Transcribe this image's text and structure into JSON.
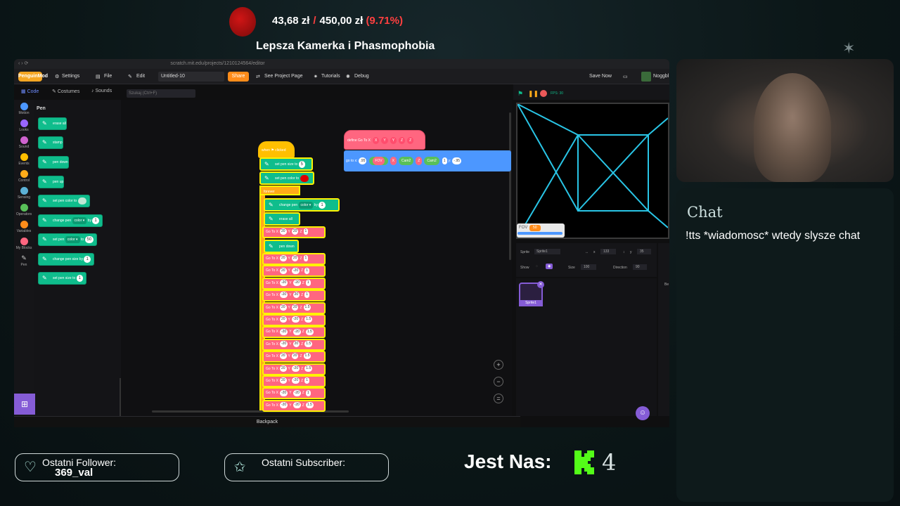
{
  "goal": {
    "current": "43,68 zł",
    "separator": "/",
    "target": "450,00 zł",
    "percent": "(9.71%)"
  },
  "stream_title": "Lepsza Kamerka i Phasmophobia",
  "browser": {
    "url": "scratch.mit.edu/projects/1210124564/editor",
    "menu": {
      "logo": "PenguinMod",
      "settings": "Settings",
      "file": "File",
      "edit": "Edit",
      "project_title": "Untitled-10",
      "share": "Share",
      "see_project": "See Project Page",
      "tutorials": "Tutorials",
      "debug": "Debug",
      "save_now": "Save Now",
      "user": "Noggbl"
    },
    "tabs": {
      "code": "Code",
      "costumes": "Costumes",
      "sounds": "Sounds"
    },
    "search_placeholder": "Szukaj (Ctrl+F)",
    "categories": [
      {
        "label": "Motion",
        "color": "#4c97ff"
      },
      {
        "label": "Looks",
        "color": "#9966ff"
      },
      {
        "label": "Sound",
        "color": "#cf63cf"
      },
      {
        "label": "Events",
        "color": "#ffbf00"
      },
      {
        "label": "Control",
        "color": "#ffab19"
      },
      {
        "label": "Sensing",
        "color": "#5cb1d6"
      },
      {
        "label": "Operators",
        "color": "#59c059"
      },
      {
        "label": "Variables",
        "color": "#ff8c1a"
      },
      {
        "label": "My Blocks",
        "color": "#ff6680"
      },
      {
        "label": "Pen",
        "color": "#0fbd8c"
      }
    ],
    "palette": {
      "title": "Pen",
      "blocks": [
        {
          "label": "erase all"
        },
        {
          "label": "stamp"
        },
        {
          "label": "pen down"
        },
        {
          "label": "pen up"
        },
        {
          "label": "set pen color to"
        },
        {
          "label": "change pen",
          "opt": "color ▾",
          "by": "by",
          "val": "1"
        },
        {
          "label": "set pen",
          "opt": "color ▾",
          "by": "to",
          "val": "50"
        },
        {
          "label": "change pen size by",
          "val": "1"
        },
        {
          "label": "set pen size to",
          "val": "1"
        }
      ]
    },
    "script": {
      "hat": "when ⚑ clicked",
      "set_size": {
        "label": "set pen size to",
        "val": "5"
      },
      "set_color": "set pen color to",
      "forever": "forever",
      "change_pen": {
        "label": "change pen",
        "opt": "color ▾",
        "by": "by",
        "val": "1"
      },
      "erase": "erase all",
      "goto_first": {
        "label": "Go To X",
        "x": "20",
        "y": "Y",
        "yv": "20",
        "z": "Z",
        "zv": "1"
      },
      "pen_down": "pen down",
      "goto_rows": [
        {
          "x": "20",
          "y": "20",
          "z": "1"
        },
        {
          "x": "20",
          "y": "-20",
          "z": "1"
        },
        {
          "x": "-20",
          "y": "-20",
          "z": "1"
        },
        {
          "x": "-20",
          "y": "20",
          "z": "1"
        },
        {
          "x": "20",
          "y": "20",
          "z": "1.5"
        },
        {
          "x": "20",
          "y": "-20",
          "z": "1.5"
        },
        {
          "x": "-20",
          "y": "-20",
          "z": "1.5"
        },
        {
          "x": "-20",
          "y": "20",
          "z": "1.5"
        },
        {
          "x": "20",
          "y": "20",
          "z": "1.5"
        },
        {
          "x": "20",
          "y": "-20",
          "z": "1.5"
        },
        {
          "x": "20",
          "y": "-20",
          "z": "1"
        },
        {
          "x": "-20",
          "y": "-20",
          "z": "1"
        },
        {
          "x": "-20",
          "y": "-20",
          "z": "1.5"
        }
      ],
      "goto_label": "Go To X",
      "y_label": "Y",
      "z_label": "Z"
    },
    "define": {
      "label": "define",
      "name": "Go To X",
      "args": [
        "X",
        "Y",
        "Y",
        "Z",
        "Z"
      ]
    },
    "goto_long": {
      "label": "go to x:",
      "v1": ".95",
      "fov": "FOV",
      "x": "X",
      "cam": "Cam2",
      "z": "Z",
      "one": "1",
      "y": "y:",
      "v2": "-.95"
    },
    "backpack": "Backpack",
    "stage": {
      "fps": "FPS: 30",
      "fov_label": "FOV",
      "fov_value": "50"
    },
    "sprite_info": {
      "sprite_label": "Sprite",
      "sprite_name": "Sprite1",
      "x_label": "x",
      "x": "133",
      "y_label": "y",
      "y": "35",
      "show_label": "Show",
      "size_label": "Size",
      "size": "100",
      "dir_label": "Direction",
      "dir": "90",
      "stage_label": "Be"
    },
    "sprite_thumb": "Sprite1"
  },
  "chat": {
    "title": "Chat",
    "message": "!tts *wiadomosc* wtedy slysze chat"
  },
  "follower": {
    "label": "Ostatni Follower:",
    "name": "369_val"
  },
  "subscriber": {
    "label": "Ostatni Subscriber:",
    "name": ""
  },
  "viewers": {
    "label": "Jest Nas:",
    "count": "4"
  },
  "colors": {
    "accent_kick": "#53fc18",
    "stage_lines": "#29c5e6"
  }
}
